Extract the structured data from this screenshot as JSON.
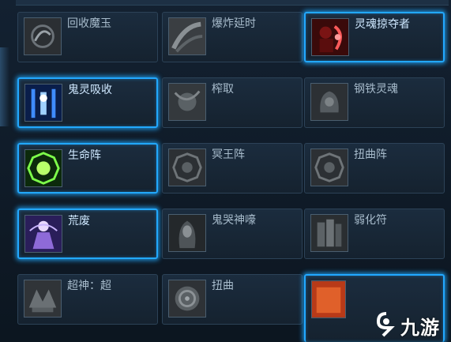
{
  "skills": [
    {
      "label": "回收魔玉",
      "active": false,
      "icon": "dark-swirl-icon"
    },
    {
      "label": "爆炸延时",
      "active": false,
      "icon": "explosion-delay-icon"
    },
    {
      "label": "灵魂掠夺者",
      "active": true,
      "icon": "soul-reaver-icon"
    },
    {
      "label": "鬼灵吸收",
      "active": true,
      "icon": "spirit-absorb-icon"
    },
    {
      "label": "榨取",
      "active": false,
      "icon": "extract-icon"
    },
    {
      "label": "钢铁灵魂",
      "active": false,
      "icon": "iron-soul-icon"
    },
    {
      "label": "生命阵",
      "active": true,
      "icon": "life-circle-icon"
    },
    {
      "label": "冥王阵",
      "active": false,
      "icon": "hades-circle-icon"
    },
    {
      "label": "扭曲阵",
      "active": false,
      "icon": "twist-circle-icon"
    },
    {
      "label": "荒废",
      "active": true,
      "icon": "desolation-icon"
    },
    {
      "label": "鬼哭神嚎",
      "active": false,
      "icon": "wail-icon"
    },
    {
      "label": "弱化符",
      "active": false,
      "icon": "weaken-icon"
    },
    {
      "label": "超神：超",
      "active": false,
      "icon": "godlike-icon"
    },
    {
      "label": "扭曲",
      "active": false,
      "icon": "twist-icon"
    },
    {
      "label": "",
      "active": true,
      "icon": "partial-skill-icon"
    }
  ],
  "watermark": {
    "text": "九游",
    "icon": "9you-logo-icon"
  },
  "colors": {
    "accent": "#22a8ff",
    "label": "#cfe8ff",
    "panel": "#1b2c3e"
  }
}
